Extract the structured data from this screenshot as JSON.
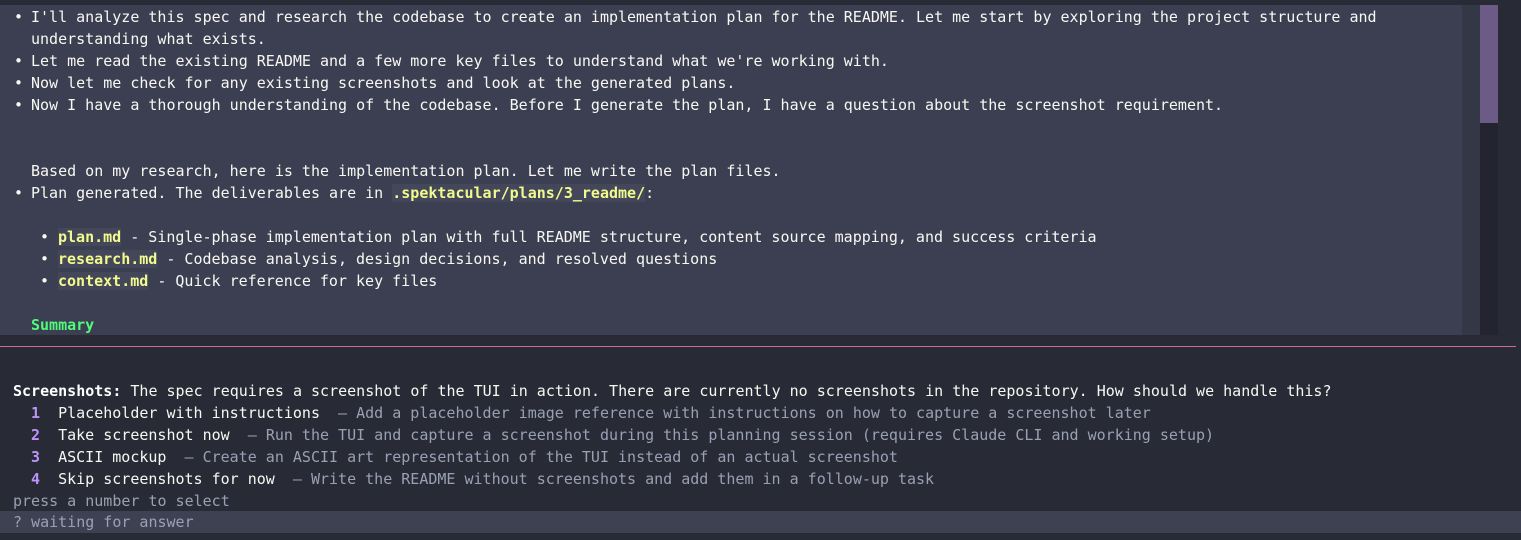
{
  "output": {
    "paragraphs": [
      {
        "bullet": "•",
        "lines": [
          "I'll analyze this spec and research the codebase to create an implementation plan for the README. Let me start by exploring the project structure and",
          "understanding what exists."
        ]
      },
      {
        "bullet": "•",
        "lines": [
          "Let me read the existing README and a few more key files to understand what we're working with."
        ]
      },
      {
        "bullet": "•",
        "lines": [
          "Now let me check for any existing screenshots and look at the generated plans."
        ]
      },
      {
        "bullet": "•",
        "lines": [
          "Now I have a thorough understanding of the codebase. Before I generate the plan, I have a question about the screenshot requirement."
        ]
      }
    ],
    "research_line": "Based on my research, here is the implementation plan. Let me write the plan files.",
    "plan_generated": {
      "bullet": "•",
      "prefix": "Plan generated. The deliverables are in ",
      "path": ".spektacular/plans/3_readme/",
      "suffix": ":"
    },
    "files": [
      {
        "bullet": "•",
        "name": "plan.md",
        "description": " - Single-phase implementation plan with full README structure, content source mapping, and success criteria"
      },
      {
        "bullet": "•",
        "name": "research.md",
        "description": " - Codebase analysis, design decisions, and resolved questions"
      },
      {
        "bullet": "•",
        "name": "context.md",
        "description": " - Quick reference for key files"
      }
    ],
    "summary_heading": "Summary"
  },
  "question": {
    "title": "Screenshots:",
    "text": " The spec requires a screenshot of the TUI in action. There are currently no screenshots in the repository. How should we handle this?",
    "options": [
      {
        "number": "1",
        "label": "Placeholder with instructions",
        "separator": " — ",
        "description": "Add a placeholder image reference with instructions on how to capture a screenshot later"
      },
      {
        "number": "2",
        "label": "Take screenshot now",
        "separator": " — ",
        "description": "Run the TUI and capture a screenshot during this planning session (requires Claude CLI and working setup)"
      },
      {
        "number": "3",
        "label": "ASCII mockup",
        "separator": " — ",
        "description": "Create an ASCII art representation of the TUI instead of an actual screenshot"
      },
      {
        "number": "4",
        "label": "Skip screenshots for now",
        "separator": " — ",
        "description": "Write the README without screenshots and add them in a follow-up task"
      }
    ],
    "hint": "press a number to select"
  },
  "status": {
    "text": "? waiting for answer"
  },
  "colors": {
    "background": "#282a36",
    "panel": "#3c3f52",
    "code_highlight": "#f1fa8c",
    "summary": "#50fa7b",
    "option_number": "#bd93f9",
    "divider": "#d0689d",
    "scroll_thumb": "#6c5a87"
  }
}
